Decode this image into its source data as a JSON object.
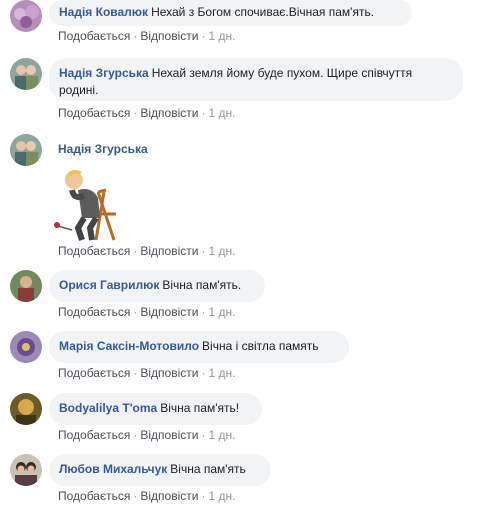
{
  "actions": {
    "like": "Подобається",
    "reply": "Відповісти",
    "sep": "·"
  },
  "comments": [
    {
      "author": "Надія Ковалюк",
      "text": "Нехай з Богом спочиває.Вічная пам'ять.",
      "time": "1 дн."
    },
    {
      "author": "Надія Згурська",
      "text": "Нехай земля йому буде пухом. Щире співчуття родині.",
      "time": "1 дн."
    },
    {
      "author": "Надія Згурська",
      "text": "",
      "sticker": "mourning-man-sticker",
      "time": "1 дн."
    },
    {
      "author": "Орися Гаврилюк",
      "text": "Вічна пам'ять.",
      "time": "1 дн."
    },
    {
      "author": "Марія Саксін-Мотовило",
      "text": "Вічна і світла память",
      "time": "1 дн."
    },
    {
      "author": "Bodyalilya T'oma",
      "text": "Вічна пам'ять!",
      "time": "1 дн."
    },
    {
      "author": "Любов Михальчук",
      "text": "Вічна пам'ять",
      "time": "1 дн."
    }
  ],
  "colors": {
    "author": "#385898",
    "bubble": "#f2f3f5",
    "meta": "#90949c"
  }
}
